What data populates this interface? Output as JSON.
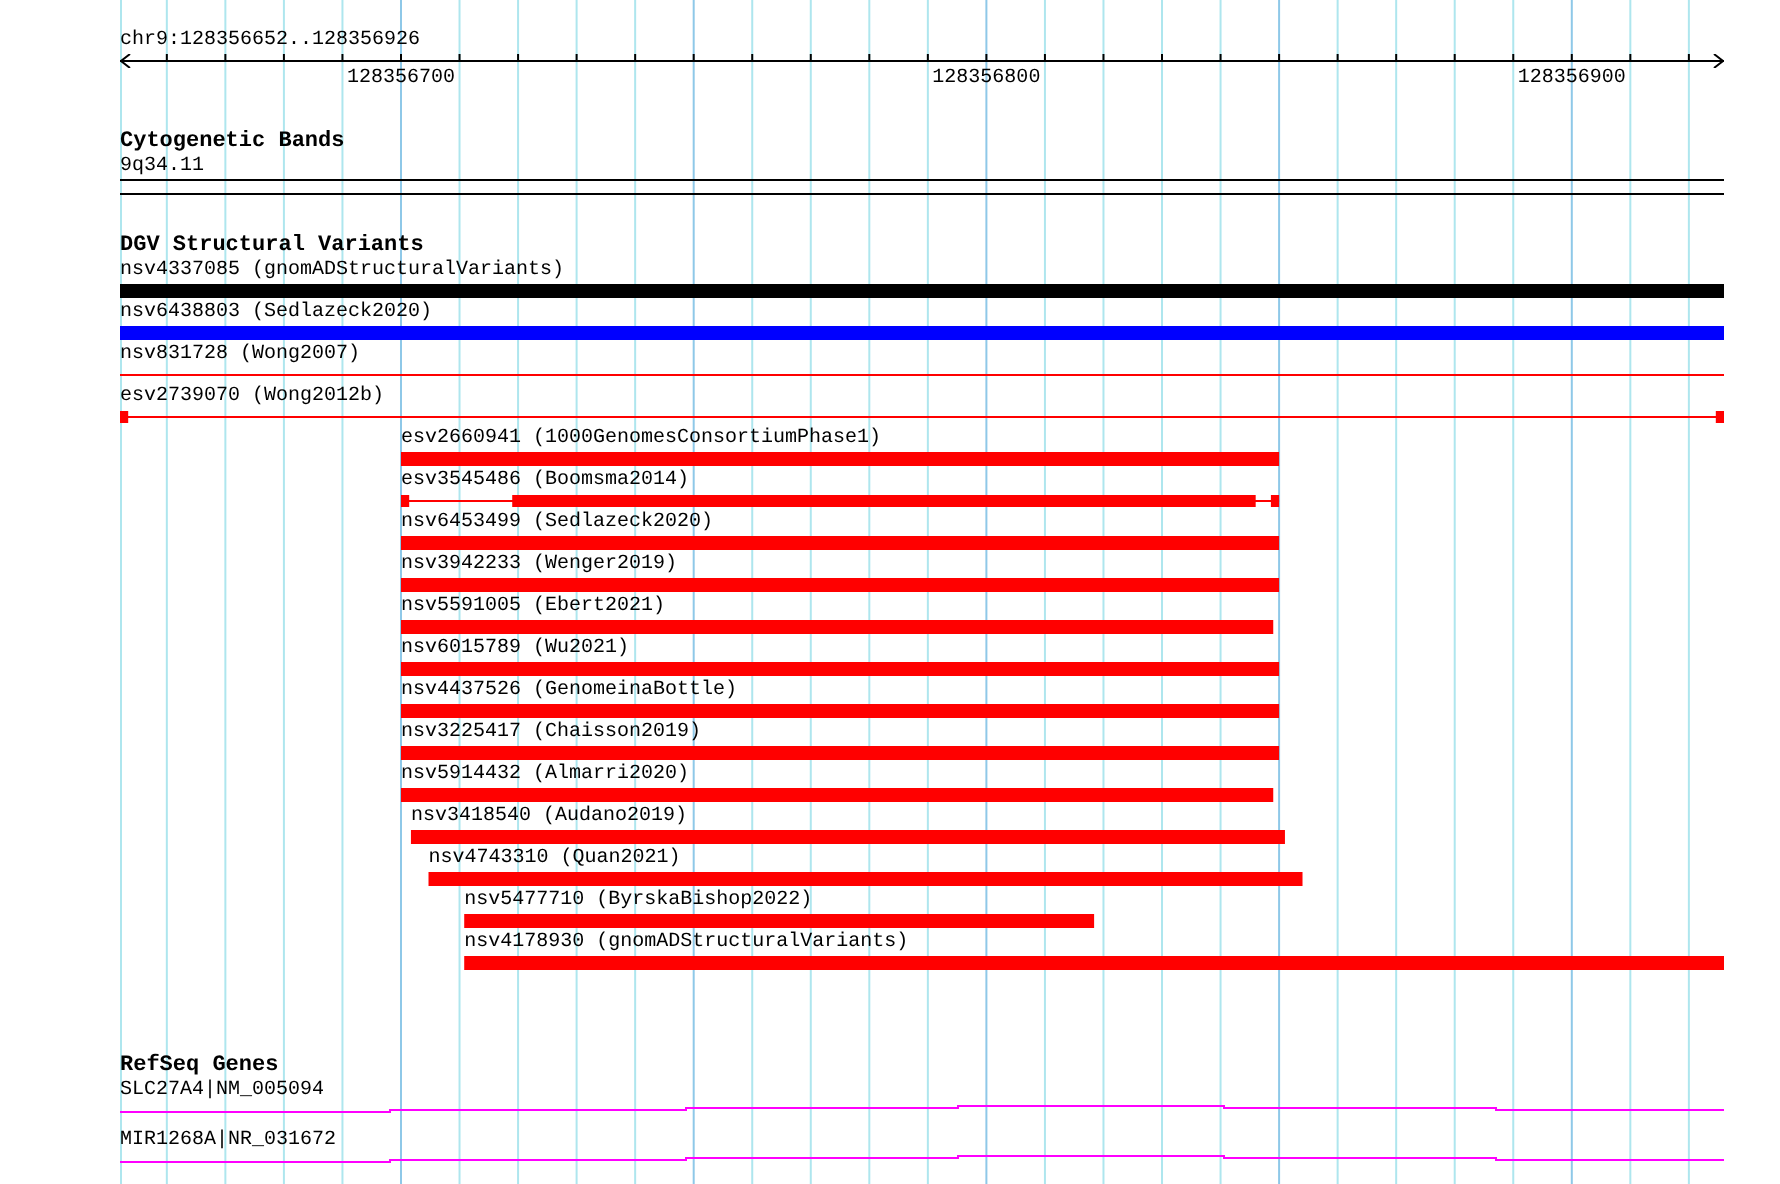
{
  "ruler": {
    "location": "chr9:128356652..128356926",
    "labels": [
      {
        "text": "128356700"
      },
      {
        "text": "128356800"
      },
      {
        "text": "128356900"
      }
    ]
  },
  "cytogenetic_bands": {
    "title": "Cytogenetic Bands",
    "band": "9q34.11"
  },
  "dgv_track": {
    "title": "DGV Structural Variants",
    "features": [
      {
        "label": "nsv4337085 (gnomADStructuralVariants)",
        "kind": "bar",
        "color": "#000000"
      },
      {
        "label": "nsv6438803 (Sedlazeck2020)",
        "kind": "bar",
        "color": "#0000ff"
      },
      {
        "label": "nsv831728 (Wong2007)",
        "kind": "line",
        "color": "#ff0000"
      },
      {
        "label": "esv2739070 (Wong2012b)",
        "kind": "gapped",
        "color": "#ff0000"
      },
      {
        "label": "esv2660941 (1000GenomesConsortiumPhase1)",
        "kind": "bar",
        "color": "#ff0000"
      },
      {
        "label": "esv3545486 (Boomsma2014)",
        "kind": "gapped",
        "color": "#ff0000"
      },
      {
        "label": "nsv6453499 (Sedlazeck2020)",
        "kind": "bar",
        "color": "#ff0000"
      },
      {
        "label": "nsv3942233 (Wenger2019)",
        "kind": "bar",
        "color": "#ff0000"
      },
      {
        "label": "nsv5591005 (Ebert2021)",
        "kind": "bar",
        "color": "#ff0000"
      },
      {
        "label": "nsv6015789 (Wu2021)",
        "kind": "bar",
        "color": "#ff0000"
      },
      {
        "label": "nsv4437526 (GenomeinaBottle)",
        "kind": "bar",
        "color": "#ff0000"
      },
      {
        "label": "nsv3225417 (Chaisson2019)",
        "kind": "bar",
        "color": "#ff0000"
      },
      {
        "label": "nsv5914432 (Almarri2020)",
        "kind": "bar",
        "color": "#ff0000"
      },
      {
        "label": "nsv3418540 (Audano2019)",
        "kind": "bar",
        "color": "#ff0000"
      },
      {
        "label": "nsv4743310 (Quan2021)",
        "kind": "bar",
        "color": "#ff0000"
      },
      {
        "label": "nsv5477710 (ByrskaBishop2022)",
        "kind": "bar",
        "color": "#ff0000"
      },
      {
        "label": "nsv4178930 (gnomADStructuralVariants)",
        "kind": "bar",
        "color": "#ff0000"
      }
    ]
  },
  "refseq_track": {
    "title": "RefSeq Genes",
    "genes": [
      {
        "label": "SLC27A4|NM_005094"
      },
      {
        "label": "MIR1268A|NR_031672"
      }
    ]
  }
}
